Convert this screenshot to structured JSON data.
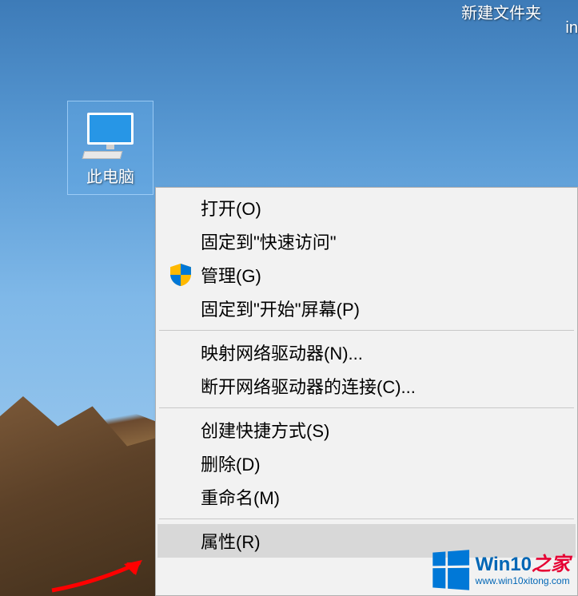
{
  "desktop": {
    "this_pc_label": "此电脑",
    "folder_label": "新建文件夹",
    "extra_label_fragment": "in"
  },
  "context_menu": {
    "open": "打开(O)",
    "pin_quick_access": "固定到\"快速访问\"",
    "manage": "管理(G)",
    "pin_start": "固定到\"开始\"屏幕(P)",
    "map_drive": "映射网络驱动器(N)...",
    "disconnect_drive": "断开网络驱动器的连接(C)...",
    "create_shortcut": "创建快捷方式(S)",
    "delete": "删除(D)",
    "rename": "重命名(M)",
    "properties": "属性(R)"
  },
  "watermark": {
    "title_main": "Win10",
    "title_suffix": "之家",
    "url": "www.win10xitong.com"
  }
}
